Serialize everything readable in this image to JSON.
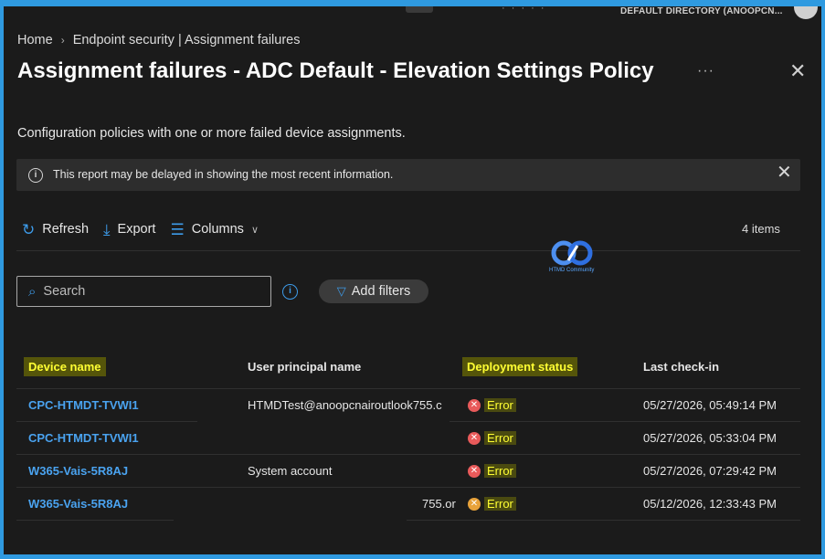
{
  "topbar": {
    "directory": "DEFAULT DIRECTORY (ANOOPCN..."
  },
  "breadcrumb": {
    "home": "Home",
    "current": "Endpoint security | Assignment failures"
  },
  "title": "Assignment failures - ADC Default - Elevation Settings Policy",
  "description": "Configuration policies with one or more failed device assignments.",
  "banner": {
    "message": "This report may be delayed in showing the most recent information."
  },
  "toolbar": {
    "refresh_label": "Refresh",
    "export_label": "Export",
    "columns_label": "Columns",
    "items_count": "4 items"
  },
  "watermark": {
    "text": "HTMD Community"
  },
  "search": {
    "placeholder": "Search"
  },
  "filters": {
    "add_label": "Add filters"
  },
  "table": {
    "columns": [
      "Device name",
      "User principal name",
      "Deployment status",
      "Last check-in"
    ],
    "rows": [
      {
        "device": "CPC-HTMDT-TVWI1",
        "upn": "HTMDTest@anoopcnairoutlook755.c",
        "status": "Error",
        "checkin": "05/27/2026, 05:49:14 PM"
      },
      {
        "device": "CPC-HTMDT-TVWI1",
        "upn": "",
        "status": "Error",
        "checkin": "05/27/2026, 05:33:04 PM"
      },
      {
        "device": "W365-Vais-5R8AJ",
        "upn": "System account",
        "status": "Error",
        "checkin": "05/27/2026, 07:29:42 PM"
      },
      {
        "device": "W365-Vais-5R8AJ",
        "upn": "755.or",
        "status": "Error",
        "checkin": "05/12/2026, 12:33:43 PM"
      }
    ]
  },
  "colors": {
    "accent": "#3d9be9",
    "link": "#4aa3f0",
    "error": "#e85a5a",
    "highlight": "#ffff33",
    "background": "#1b1b1b",
    "outer_border": "#2f9ae0"
  }
}
